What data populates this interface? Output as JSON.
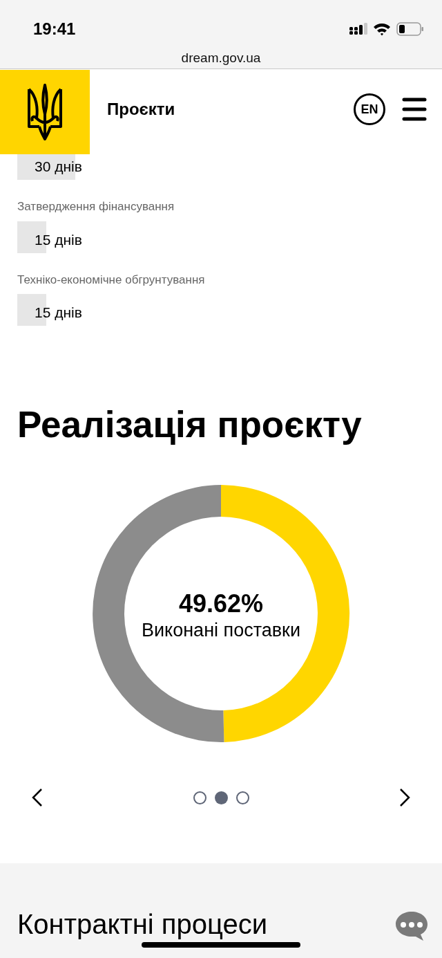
{
  "status_bar": {
    "time": "19:41"
  },
  "browser": {
    "url": "dream.gov.ua"
  },
  "header": {
    "title": "Проєкти",
    "language_button": "EN"
  },
  "durations": [
    {
      "value": "30 днів"
    },
    {
      "label": "Затвердження фінансування",
      "value": "15 днів"
    },
    {
      "label": "Техніко-економічне обгрунтування",
      "value": "15 днів"
    }
  ],
  "implementation": {
    "heading": "Реалізація проєкту",
    "percent": "49.62%",
    "caption": "Виконані поставки",
    "chart_data": {
      "type": "donut",
      "values": [
        49.62,
        50.38
      ]
    },
    "carousel": {
      "dots": [
        {
          "selected": false
        },
        {
          "selected": true
        },
        {
          "selected": false
        }
      ]
    }
  },
  "next_section": {
    "heading": "Контрактні процеси"
  }
}
